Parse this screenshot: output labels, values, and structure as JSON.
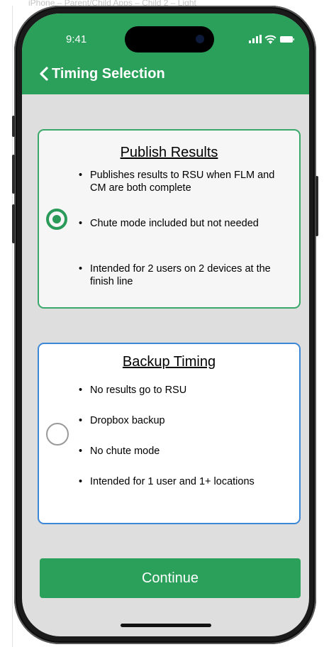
{
  "frame": {
    "caption": "iPhone – Parent/Child Apps – Child 2 – Light"
  },
  "status_bar": {
    "time": "9:41",
    "icons": [
      "signal-icon",
      "wifi-icon",
      "battery-icon"
    ]
  },
  "nav": {
    "back_icon": "chevron-left-icon",
    "title": "Timing Selection"
  },
  "options": [
    {
      "title": "Publish Results",
      "selected": true,
      "bullets": [
        "Publishes results to RSU when FLM and CM are both complete",
        "Chute mode included but not needed",
        "Intended for 2 users on 2 devices at the finish line"
      ]
    },
    {
      "title": "Backup Timing",
      "selected": false,
      "bullets": [
        "No results go to RSU",
        "Dropbox backup",
        "No chute mode",
        "Intended for 1 user and 1+ locations"
      ]
    }
  ],
  "continue_button": {
    "label": "Continue"
  },
  "colors": {
    "accent": "#2aa05a",
    "selected_border": "#3aa86a",
    "focused_border": "#3c87d6",
    "screen_background": "#dedede"
  }
}
